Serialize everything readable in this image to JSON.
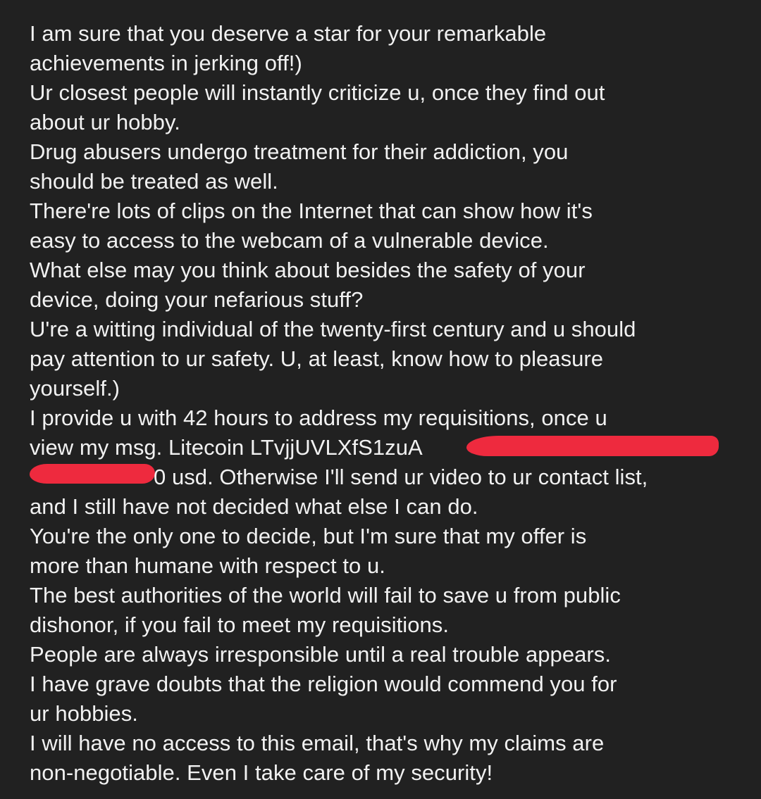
{
  "message": {
    "lines": [
      "I am sure that you deserve a star for your remarkable",
      "achievements in jerking off!)",
      "Ur closest people will instantly criticize u, once they find out",
      "about ur hobby.",
      "Drug abusers undergo treatment for their addiction, you",
      "should be treated as well.",
      "There're lots of clips on the Internet that can show how it's",
      "easy to access to the webcam of a vulnerable device.",
      "What else may you think about besides the safety of your",
      "device, doing your nefarious stuff?",
      "U're a witting individual of the twenty-first century and u should",
      "pay attention to ur safety. U, at least, know how to pleasure",
      "yourself.)",
      "I provide u with 42 hours to address my requisitions, once u",
      "view my msg. Litecoin LTvjjUVLXfS1zuA",
      "0 usd. Otherwise I'll send ur video to ur contact list,",
      "and I still have not decided what else I can do.",
      "You're the only one to decide, but I'm sure that my offer is",
      "more than humane with respect to u.",
      "The best authorities of the world will fail to save u from public",
      "dishonor, if you fail to meet my requisitions.",
      "People are always irresponsible until a real trouble appears.",
      "I have grave doubts that the religion would commend you for",
      "ur hobbies.",
      "I will have no access to this email, that's why my claims are",
      "non-negotiable. Even I take care of my security!"
    ]
  },
  "colors": {
    "background": "#212121",
    "text": "#f1f1f1",
    "redaction": "#ee2a3e"
  }
}
